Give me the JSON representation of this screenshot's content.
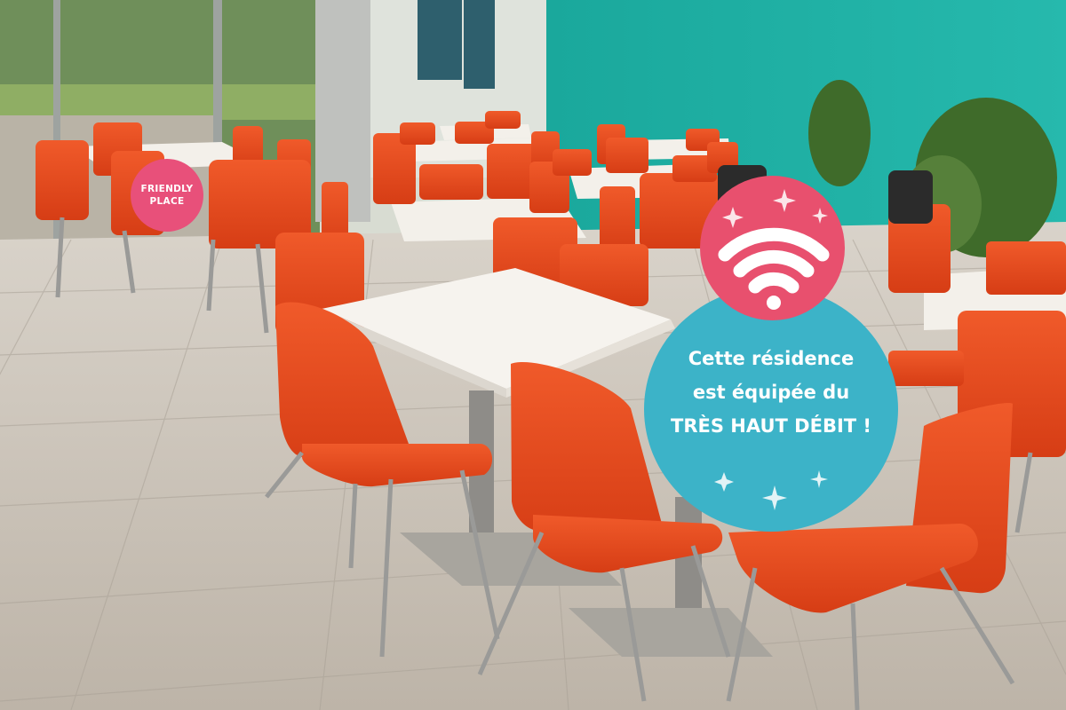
{
  "badge_friendly": {
    "line1": "FRIENDLY",
    "line2": "PLACE",
    "color": "#e8507a"
  },
  "wifi_bubble": {
    "line1": "Cette résidence",
    "line2": "est équipée du",
    "line3": "TRÈS HAUT DÉBIT !",
    "icon": "wifi-icon",
    "circle_color": "#3cb3c8",
    "icon_circle_color": "#e8506e"
  },
  "scene": {
    "wall_color": "#1fb3a6",
    "chair_color": "#e8471f",
    "table_color": "#f3f0ea",
    "floor_color": "#cbc4ba"
  }
}
